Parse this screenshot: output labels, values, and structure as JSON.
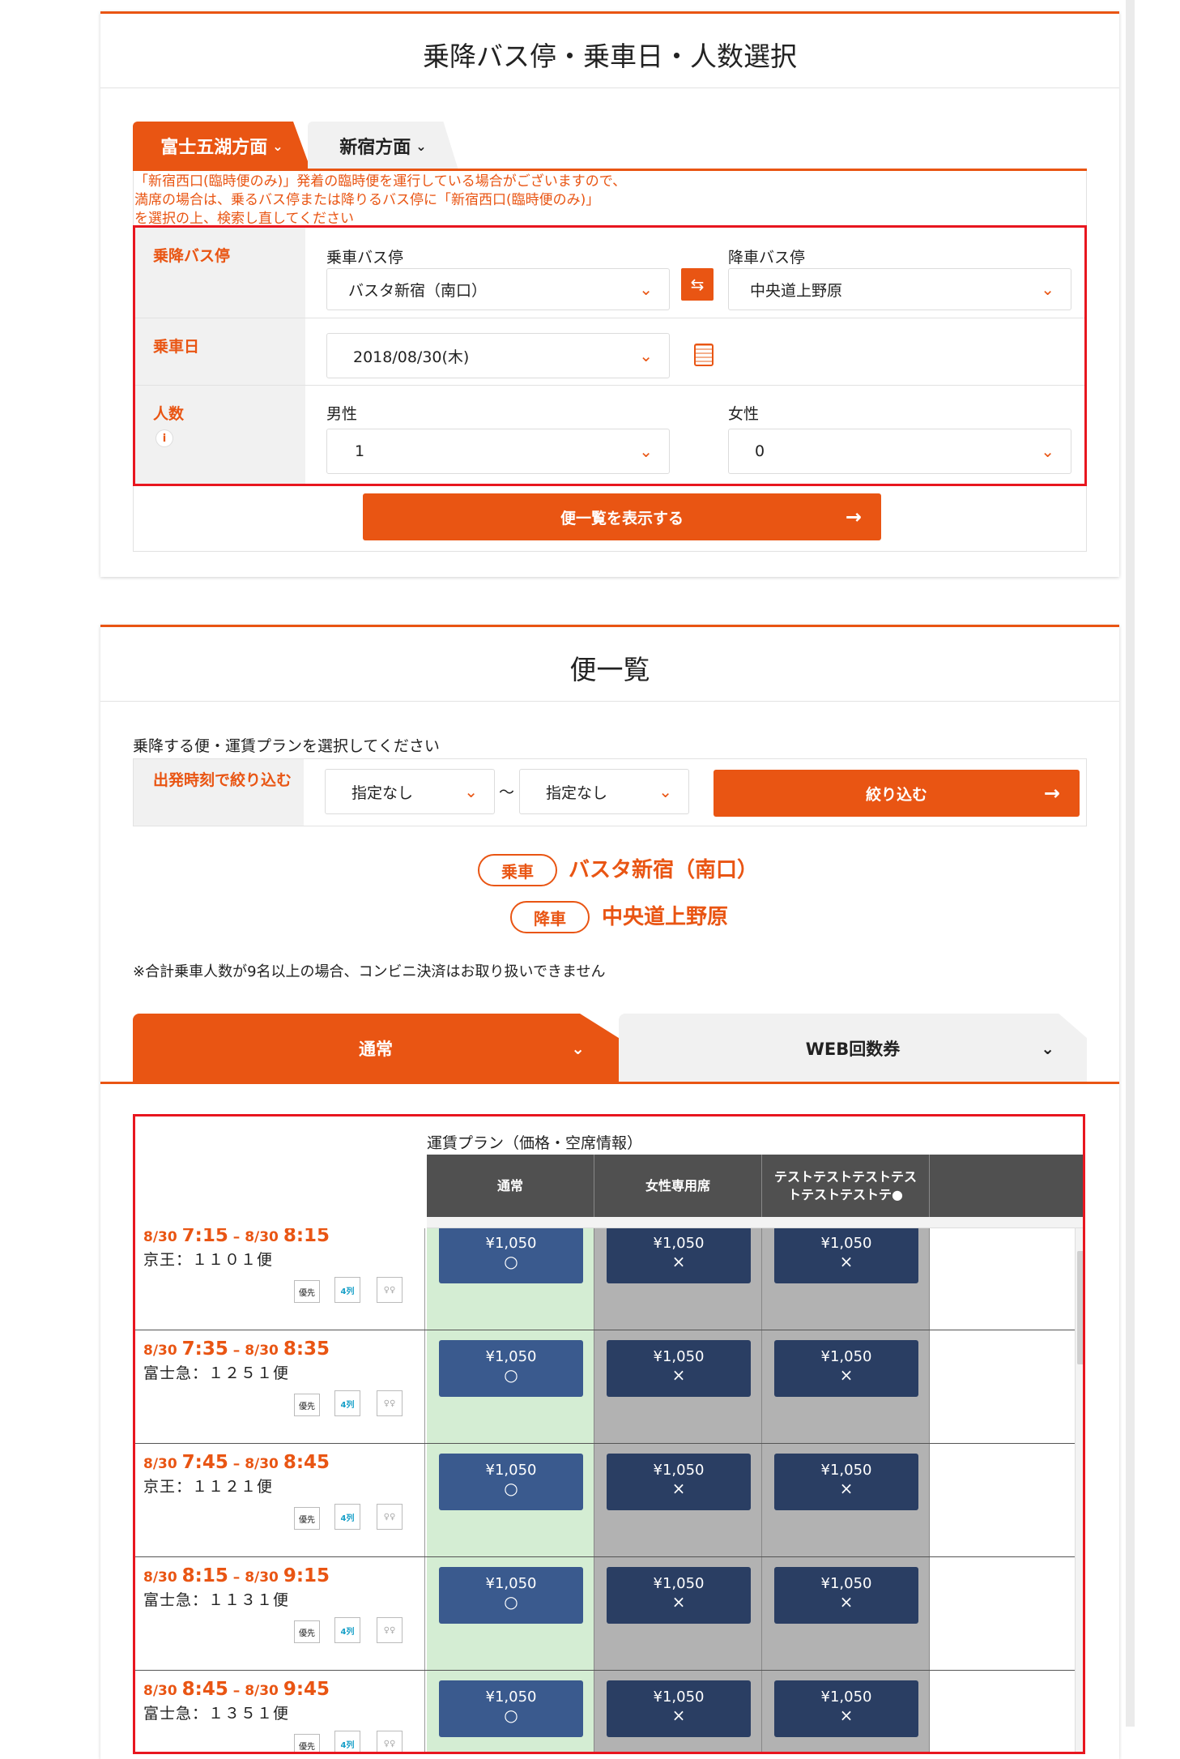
{
  "search": {
    "title": "乗降バス停・乗車日・人数選択",
    "tabs": [
      "富士五湖方面",
      "新宿方面"
    ],
    "notice": "「新宿西口(臨時便のみ)」発着の臨時便を運行している場合がございますので、\n満席の場合は、乗るバス停または降りるバス停に「新宿西口(臨時便のみ)」\nを選択の上、検索し直してください",
    "stops_label": "乗降バス停",
    "board_label": "乗車バス停",
    "board_value": "バスタ新宿（南口）",
    "alight_label": "降車バス停",
    "alight_value": "中央道上野原",
    "swap_icon": "⇆",
    "date_label": "乗車日",
    "date_value": "2018/08/30(木)",
    "people_label": "人数",
    "info_icon": "i",
    "male_label": "男性",
    "male_value": "1",
    "female_label": "女性",
    "female_value": "0",
    "show_button": "便一覧を表示する",
    "arrow": "→",
    "chevron": "⌄"
  },
  "list": {
    "title": "便一覧",
    "instruction": "乗降する便・運賃プランを選択してください",
    "filter_label": "出発時刻で絞り込む",
    "from_value": "指定なし",
    "tilde": "〜",
    "to_value": "指定なし",
    "filter_button": "絞り込む",
    "board_pill": "乗車",
    "board_stop": "バスタ新宿（南口）",
    "alight_pill": "降車",
    "alight_stop": "中央道上野原",
    "note": "※合計乗車人数が9名以上の場合、コンビニ決済はお取り扱いできません",
    "tabs": [
      "通常",
      "WEB回数券"
    ],
    "plan_header": "運賃プラン（価格・空席情報）",
    "columns": [
      "通常",
      "女性専用席",
      "テストテストテストテストテストテストテ●"
    ],
    "icons": [
      "優先",
      "4列",
      "女性"
    ],
    "rows": [
      {
        "d1": "8/30",
        "t1": "7:15",
        "d2": "8/30",
        "t2": "8:15",
        "service": "京王：１１０１便",
        "prices": [
          {
            "p": "¥1,050",
            "m": "○"
          },
          {
            "p": "¥1,050",
            "m": "×"
          },
          {
            "p": "¥1,050",
            "m": "×"
          }
        ]
      },
      {
        "d1": "8/30",
        "t1": "7:35",
        "d2": "8/30",
        "t2": "8:35",
        "service": "富士急：１２５１便",
        "prices": [
          {
            "p": "¥1,050",
            "m": "○"
          },
          {
            "p": "¥1,050",
            "m": "×"
          },
          {
            "p": "¥1,050",
            "m": "×"
          }
        ]
      },
      {
        "d1": "8/30",
        "t1": "7:45",
        "d2": "8/30",
        "t2": "8:45",
        "service": "京王：１１２１便",
        "prices": [
          {
            "p": "¥1,050",
            "m": "○"
          },
          {
            "p": "¥1,050",
            "m": "×"
          },
          {
            "p": "¥1,050",
            "m": "×"
          }
        ]
      },
      {
        "d1": "8/30",
        "t1": "8:15",
        "d2": "8/30",
        "t2": "9:15",
        "service": "富士急：１１３１便",
        "prices": [
          {
            "p": "¥1,050",
            "m": "○"
          },
          {
            "p": "¥1,050",
            "m": "×"
          },
          {
            "p": "¥1,050",
            "m": "×"
          }
        ]
      },
      {
        "d1": "8/30",
        "t1": "8:45",
        "d2": "8/30",
        "t2": "9:45",
        "service": "富士急：１３５１便",
        "prices": [
          {
            "p": "¥1,050",
            "m": "○"
          },
          {
            "p": "¥1,050",
            "m": "×"
          },
          {
            "p": "¥1,050",
            "m": "×"
          }
        ]
      }
    ]
  },
  "colors": {
    "accent": "#e95513",
    "highlight": "#e8161f",
    "price_button": "#3a5a8e"
  }
}
